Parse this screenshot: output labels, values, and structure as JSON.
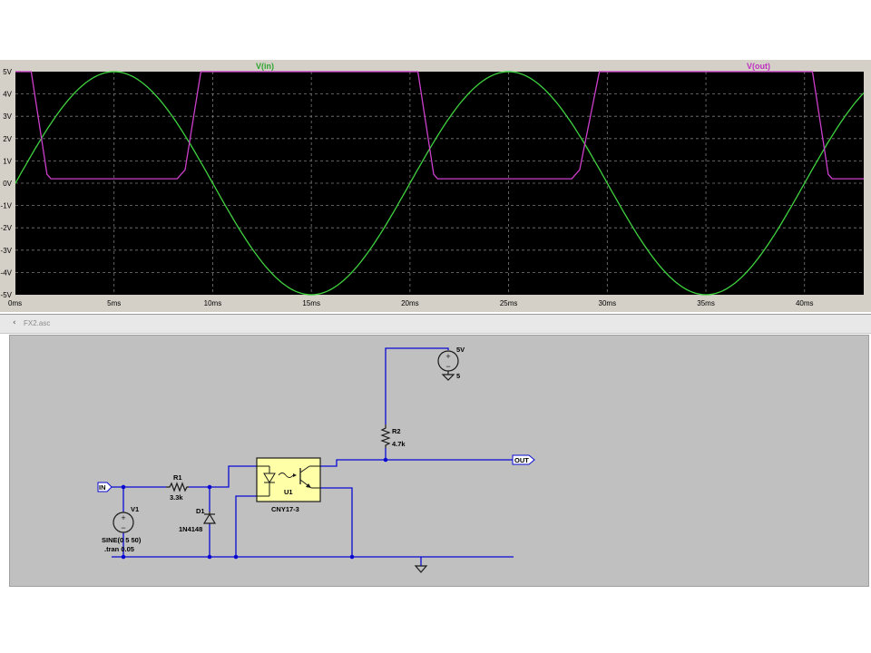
{
  "schematic": {
    "tab_title": "FX2.asc",
    "nets": {
      "in": "IN",
      "out": "OUT"
    },
    "components": {
      "v1": {
        "name": "V1",
        "value": "SINE(0 5 50)",
        "directive": ".tran 0.05"
      },
      "r1": {
        "name": "R1",
        "value": "3.3k"
      },
      "d1": {
        "name": "D1",
        "value": "1N4148"
      },
      "u1": {
        "name": "U1",
        "value": "CNY17-3"
      },
      "r2": {
        "name": "R2",
        "value": "4.7k"
      },
      "v2": {
        "name": "5V",
        "value": "5"
      }
    },
    "icons": {
      "tab": "schematic-icon",
      "ground": "ground-icon"
    }
  },
  "chart_data": {
    "type": "line",
    "xlabel": "",
    "ylabel": "",
    "xlim": [
      0,
      43
    ],
    "ylim": [
      -5,
      5
    ],
    "grid": true,
    "x_ticks": [
      "0ms",
      "5ms",
      "10ms",
      "15ms",
      "20ms",
      "25ms",
      "30ms",
      "35ms",
      "40ms"
    ],
    "y_ticks": [
      "5V",
      "4V",
      "3V",
      "2V",
      "1V",
      "0V",
      "-1V",
      "-2V",
      "-3V",
      "-4V",
      "-5V"
    ],
    "series": [
      {
        "name": "V(in)",
        "color": "#3fd23f",
        "x": [
          0,
          1,
          2,
          3,
          4,
          5,
          6,
          7,
          8,
          9,
          10,
          11,
          12,
          13,
          14,
          15,
          16,
          17,
          18,
          19,
          20,
          21,
          22,
          23,
          24,
          25,
          26,
          27,
          28,
          29,
          30,
          31,
          32,
          33,
          34,
          35,
          36,
          37,
          38,
          39,
          40,
          41,
          42,
          43
        ],
        "values": [
          0,
          1.55,
          2.94,
          4.05,
          4.76,
          5,
          4.76,
          4.05,
          2.94,
          1.55,
          0,
          -1.55,
          -2.94,
          -4.05,
          -4.76,
          -5,
          -4.76,
          -4.05,
          -2.94,
          -1.55,
          0,
          1.55,
          2.94,
          4.05,
          4.76,
          5,
          4.76,
          4.05,
          2.94,
          1.55,
          0,
          -1.55,
          -2.94,
          -4.05,
          -4.76,
          -5,
          -4.76,
          -4.05,
          -2.94,
          -1.55,
          0,
          1.55,
          2.94,
          4.05
        ]
      },
      {
        "name": "V(out)",
        "color": "#cc3fcc",
        "x": [
          0,
          0.8,
          1.6,
          1.8,
          8.2,
          8.6,
          9.4,
          20.4,
          21.2,
          21.4,
          28.2,
          28.6,
          29.6,
          40.4,
          41.2,
          41.4,
          43
        ],
        "values": [
          5,
          5,
          0.4,
          0.2,
          0.2,
          0.6,
          5,
          5,
          0.4,
          0.2,
          0.2,
          0.6,
          5,
          5,
          0.4,
          0.2,
          0.2
        ]
      }
    ]
  }
}
